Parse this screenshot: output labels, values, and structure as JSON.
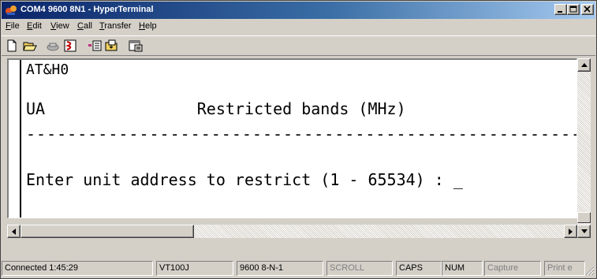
{
  "window": {
    "title": "COM4 9600 8N1 - HyperTerminal",
    "icons": [
      "hyperterminal-app-icon",
      "minimize-icon",
      "maximize-icon",
      "close-icon"
    ]
  },
  "menu": {
    "file": {
      "u": "F",
      "rest": "ile"
    },
    "edit": {
      "u": "E",
      "rest": "dit"
    },
    "view": {
      "u": "V",
      "rest": "iew"
    },
    "call": {
      "u": "C",
      "rest": "all"
    },
    "transfer": {
      "u": "T",
      "rest": "ransfer"
    },
    "help": {
      "u": "H",
      "rest": "elp"
    }
  },
  "toolbar": {
    "icons": [
      "new-document-icon",
      "open-folder-icon",
      "disconnect-phone-icon",
      "disconnect-icon",
      "send-file-icon",
      "receive-file-icon",
      "properties-icon"
    ]
  },
  "terminal": {
    "line1": "AT&H0",
    "line2": "UA                Restricted bands (MHz)",
    "line3": "--------------------------------------------------------------------------------",
    "line4": "Enter unit address to restrict (1 - 65534) : _"
  },
  "statusbar": {
    "connected": "Connected 1:45:29",
    "emulation": "VT100J",
    "settings": "9600 8-N-1",
    "scroll": "SCROLL",
    "caps": "CAPS",
    "num": "NUM",
    "capture": "Capture",
    "print_echo": "Print e"
  },
  "colors": {
    "title_gradient_start": "#0a246a",
    "title_gradient_end": "#a6caf0",
    "face": "#d4d0c8",
    "terminal_bg": "#ffffff",
    "dim_text": "#808080"
  }
}
